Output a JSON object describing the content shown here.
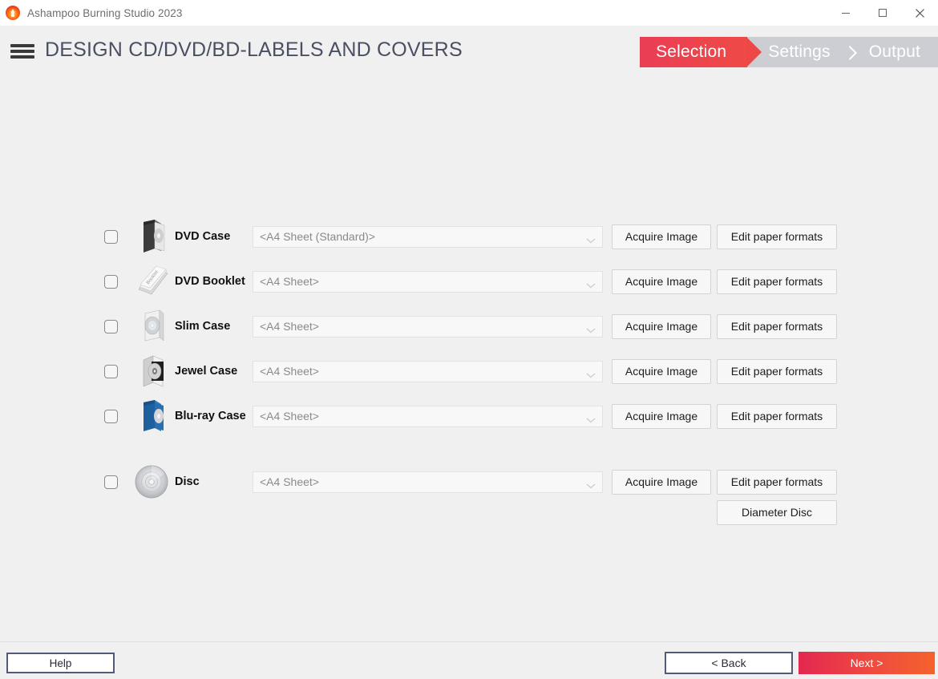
{
  "window": {
    "title": "Ashampoo Burning Studio 2023",
    "logo_icon": "flame-logo-icon",
    "minimize_icon": "minimize-icon",
    "maximize_icon": "maximize-icon",
    "close_icon": "close-icon"
  },
  "header": {
    "menu_icon": "hamburger-menu-icon",
    "title": "DESIGN CD/DVD/BD-LABELS AND COVERS",
    "steps": [
      {
        "label": "Selection",
        "state": "active"
      },
      {
        "label": "Settings",
        "state": "inactive"
      },
      {
        "label": "Output",
        "state": "inactive"
      }
    ],
    "accent_color": "#ee4747",
    "step_inactive_color": "#cdced4"
  },
  "rows": [
    {
      "label": "DVD Case",
      "icon": "dvd-case-icon",
      "checked": false,
      "paper_format": "<A4 Sheet (Standard)>",
      "acquire_label": "Acquire Image",
      "edit_label": "Edit paper formats"
    },
    {
      "label": "DVD Booklet",
      "icon": "dvd-booklet-icon",
      "checked": false,
      "paper_format": "<A4 Sheet>",
      "acquire_label": "Acquire Image",
      "edit_label": "Edit paper formats"
    },
    {
      "label": "Slim Case",
      "icon": "slim-case-icon",
      "checked": false,
      "paper_format": "<A4 Sheet>",
      "acquire_label": "Acquire Image",
      "edit_label": "Edit paper formats"
    },
    {
      "label": "Jewel Case",
      "icon": "jewel-case-icon",
      "checked": false,
      "paper_format": "<A4 Sheet>",
      "acquire_label": "Acquire Image",
      "edit_label": "Edit paper formats"
    },
    {
      "label": "Blu-ray Case",
      "icon": "bluray-case-icon",
      "checked": false,
      "paper_format": "<A4 Sheet>",
      "acquire_label": "Acquire Image",
      "edit_label": "Edit paper formats"
    },
    {
      "label": "Disc",
      "icon": "disc-icon",
      "checked": false,
      "paper_format": "<A4 Sheet>",
      "acquire_label": "Acquire Image",
      "edit_label": "Edit paper formats",
      "extra_label": "Diameter Disc"
    }
  ],
  "footer": {
    "help_label": "Help",
    "back_label": "< Back",
    "next_label": "Next >",
    "next_gradient_start": "#e32850",
    "next_gradient_end": "#f4622c",
    "outline_color": "#525a78"
  }
}
